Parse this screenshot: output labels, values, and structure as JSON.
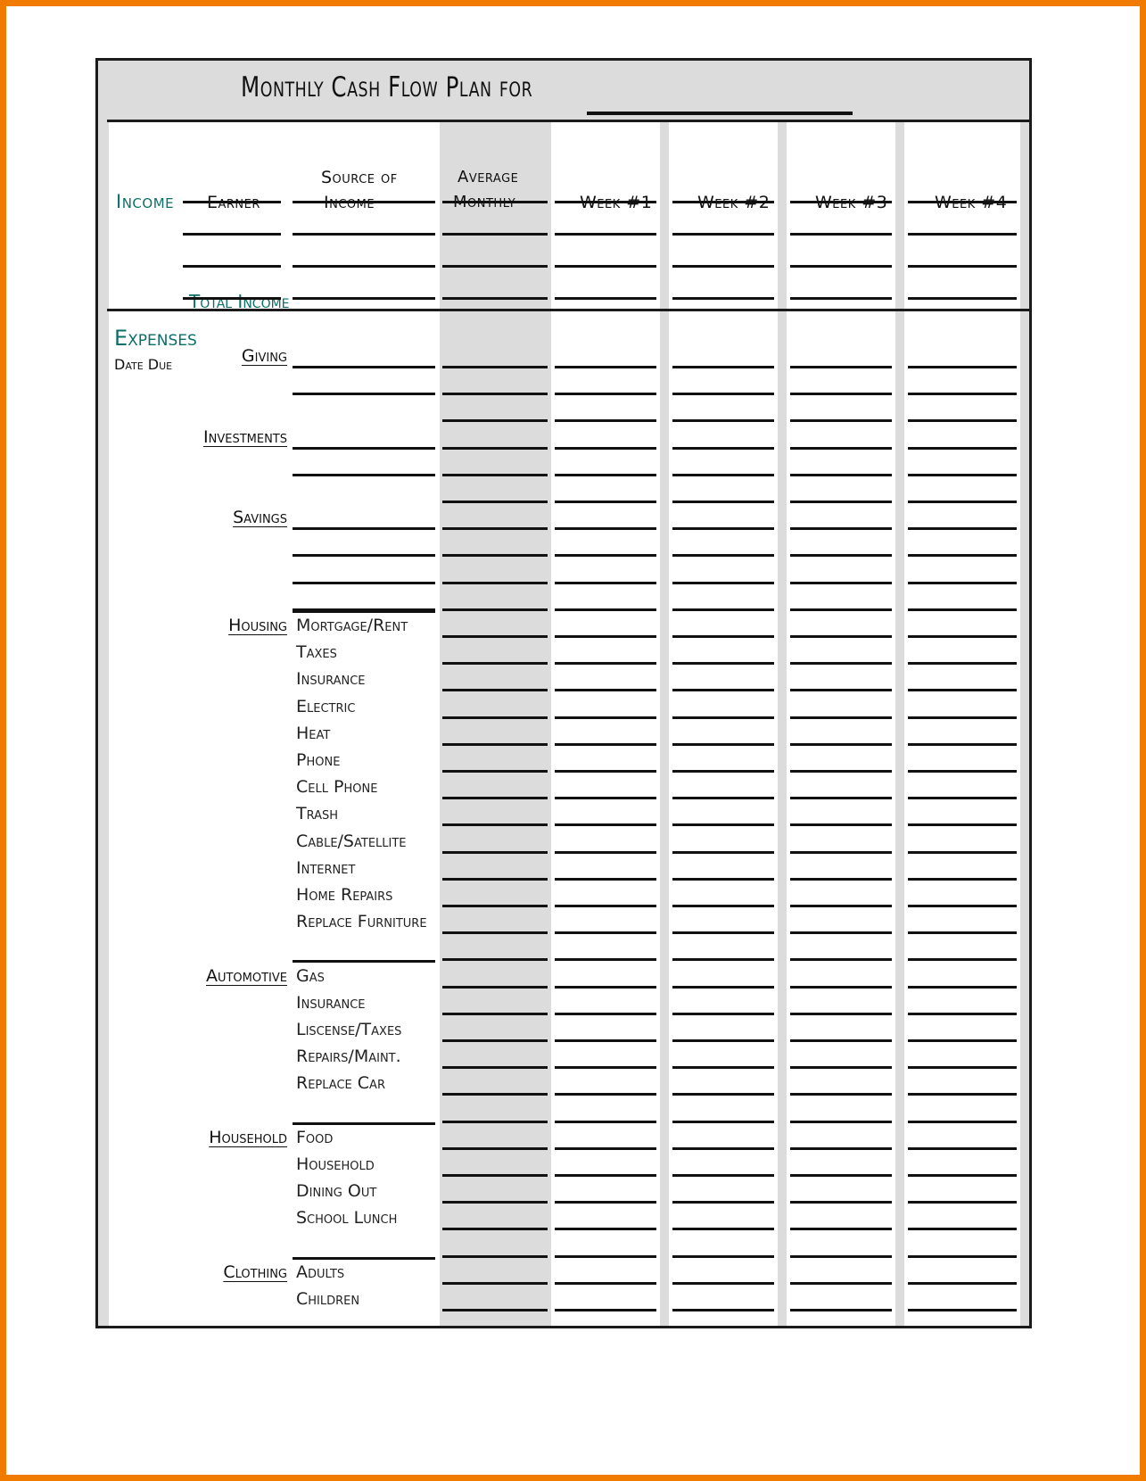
{
  "theme": {
    "border_orange": "#F07B00",
    "accent_teal": "#0c6f67",
    "shade_grey": "#dcdcdc",
    "ink": "#111111"
  },
  "document": {
    "title": "Monthly Cash Flow Plan for",
    "title_blank": ""
  },
  "income": {
    "section_label": "Income",
    "columns": {
      "earner": "Earner",
      "source_line1": "Source of",
      "source_line2": "Income",
      "average_line1": "Average",
      "average_line2": "Monthly",
      "week1": "Week #1",
      "week2": "Week #2",
      "week3": "Week #3",
      "week4": "Week #4"
    },
    "blank_rows": 4,
    "total_label": "Total Income"
  },
  "expenses": {
    "section_label": "Expenses",
    "date_due_label": "Date Due",
    "groups": [
      {
        "name": "Giving",
        "blank_items": 2,
        "items": []
      },
      {
        "name": "Investments",
        "blank_items": 2,
        "items": []
      },
      {
        "name": "Savings",
        "blank_items": 3,
        "items": []
      },
      {
        "name": "Housing",
        "blank_items": 0,
        "items": [
          "Mortgage/Rent",
          "Taxes",
          "Insurance",
          "Electric",
          "Heat",
          "Phone",
          "Cell Phone",
          "Trash",
          "Cable/Satellite",
          "Internet",
          "Home Repairs",
          "Replace Furniture"
        ]
      },
      {
        "name": "Automotive",
        "blank_items": 0,
        "items": [
          "Gas",
          "Insurance",
          "Liscense/Taxes",
          "Repairs/Maint.",
          "Replace Car"
        ]
      },
      {
        "name": "Household",
        "blank_items": 0,
        "items": [
          "Food",
          "Household",
          "Dining Out",
          "School Lunch"
        ]
      },
      {
        "name": "Clothing",
        "blank_items": 0,
        "items": [
          "Adults",
          "Children"
        ]
      }
    ]
  }
}
